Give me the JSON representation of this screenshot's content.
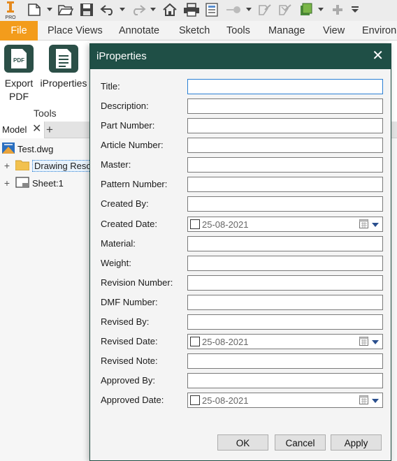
{
  "quick_access": {
    "app_icon_label": "PRO",
    "icons": [
      "app-logo-icon",
      "new-icon",
      "dropdown-arrow-icon",
      "open-icon",
      "save-icon",
      "undo-icon",
      "dropdown-arrow-icon",
      "redo-icon",
      "dropdown-arrow-icon",
      "home-icon",
      "print-icon",
      "properties-icon",
      "measure-icon",
      "dropdown-arrow-icon",
      "update-icon",
      "update-all-icon",
      "return-icon",
      "dropdown-arrow-icon",
      "plus-icon",
      "customize-arrow-icon"
    ]
  },
  "ribbon": {
    "tabs": [
      {
        "label": "File"
      },
      {
        "label": "Place Views"
      },
      {
        "label": "Annotate"
      },
      {
        "label": "Sketch"
      },
      {
        "label": "Tools"
      },
      {
        "label": "Manage"
      },
      {
        "label": "View"
      },
      {
        "label": "Environ"
      }
    ],
    "buttons": [
      {
        "line1": "Export",
        "line2": "PDF",
        "icon_text": "PDF"
      },
      {
        "line1": "iProperties",
        "line2": ""
      }
    ],
    "panel_label": "Tools"
  },
  "browser": {
    "tab_label": "Model",
    "close_glyph": "✕",
    "add_glyph": "+",
    "tree": [
      {
        "label": "Test.dwg",
        "icon": "drawing-file-icon",
        "expander": ""
      },
      {
        "label": "Drawing Reso",
        "icon": "folder-icon",
        "expander": "+"
      },
      {
        "label": "Sheet:1",
        "icon": "sheet-icon",
        "expander": "+"
      }
    ]
  },
  "dialog": {
    "title": "iProperties",
    "close_glyph": "✕",
    "fields": [
      {
        "label": "Title:",
        "type": "text",
        "value": ""
      },
      {
        "label": "Description:",
        "type": "text",
        "value": ""
      },
      {
        "label": "Part Number:",
        "type": "text",
        "value": ""
      },
      {
        "label": "Article Number:",
        "type": "text",
        "value": ""
      },
      {
        "label": "Master:",
        "type": "text",
        "value": ""
      },
      {
        "label": "Pattern Number:",
        "type": "text",
        "value": ""
      },
      {
        "label": "Created By:",
        "type": "text",
        "value": ""
      },
      {
        "label": "Created Date:",
        "type": "date",
        "value": "25-08-2021"
      },
      {
        "label": "Material:",
        "type": "text",
        "value": ""
      },
      {
        "label": "Weight:",
        "type": "text",
        "value": ""
      },
      {
        "label": "Revision Number:",
        "type": "text",
        "value": ""
      },
      {
        "label": "DMF Number:",
        "type": "text",
        "value": ""
      },
      {
        "label": "Revised By:",
        "type": "text",
        "value": ""
      },
      {
        "label": "Revised Date:",
        "type": "date",
        "value": "25-08-2021"
      },
      {
        "label": "Revised Note:",
        "type": "text",
        "value": ""
      },
      {
        "label": "Approved By:",
        "type": "text",
        "value": ""
      },
      {
        "label": "Approved Date:",
        "type": "date",
        "value": "25-08-2021"
      }
    ],
    "buttons": {
      "ok": "OK",
      "cancel": "Cancel",
      "apply": "Apply"
    }
  }
}
